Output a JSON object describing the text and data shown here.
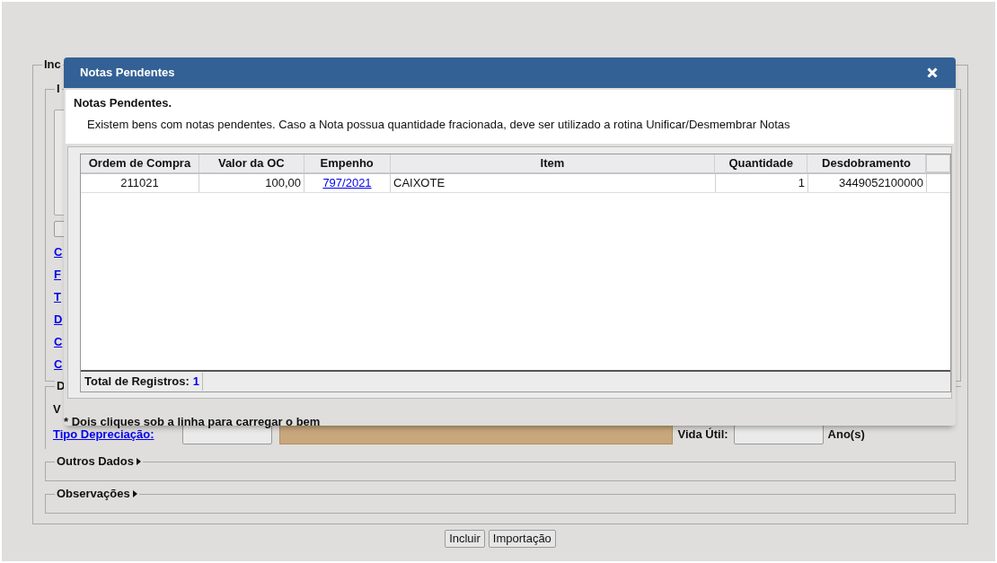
{
  "background": {
    "legends": [
      "Inc",
      "I",
      "D"
    ],
    "links": [
      "C",
      "F",
      "T",
      "D",
      "C",
      "C"
    ],
    "value_label": "V",
    "depreciation": {
      "link": "Tipo Depreciação:",
      "useful_life_label": "Vida Útil:",
      "unit": "Ano(s)"
    },
    "sections": [
      {
        "title": "Outros Dados",
        "expanded": false
      },
      {
        "title": "Observações",
        "expanded": false
      }
    ],
    "buttons": [
      "Incluir",
      "Importação"
    ]
  },
  "dialog": {
    "title": "Notas Pendentes",
    "heading": "Notas Pendentes.",
    "message": "Existem bens com notas pendentes. Caso a Nota possua quantidade fracionada, deve ser utilizado a rotina Unificar/Desmembrar Notas",
    "table": {
      "columns": [
        "Ordem de Compra",
        "Valor da OC",
        "Empenho",
        "Item",
        "Quantidade",
        "Desdobramento"
      ],
      "rows": [
        {
          "cells": [
            {
              "kind": "text",
              "text": "211021"
            },
            {
              "kind": "text",
              "text": "100,00"
            },
            {
              "kind": "link",
              "text": "797/2021"
            },
            {
              "kind": "text",
              "text": "CAIXOTE"
            },
            {
              "kind": "text",
              "text": "1"
            },
            {
              "kind": "text",
              "text": "3449052100000"
            }
          ]
        }
      ]
    },
    "total_label": "Total de Registros:",
    "total": "1",
    "note": "* Dois cliques sob a linha para carregar o bem"
  }
}
